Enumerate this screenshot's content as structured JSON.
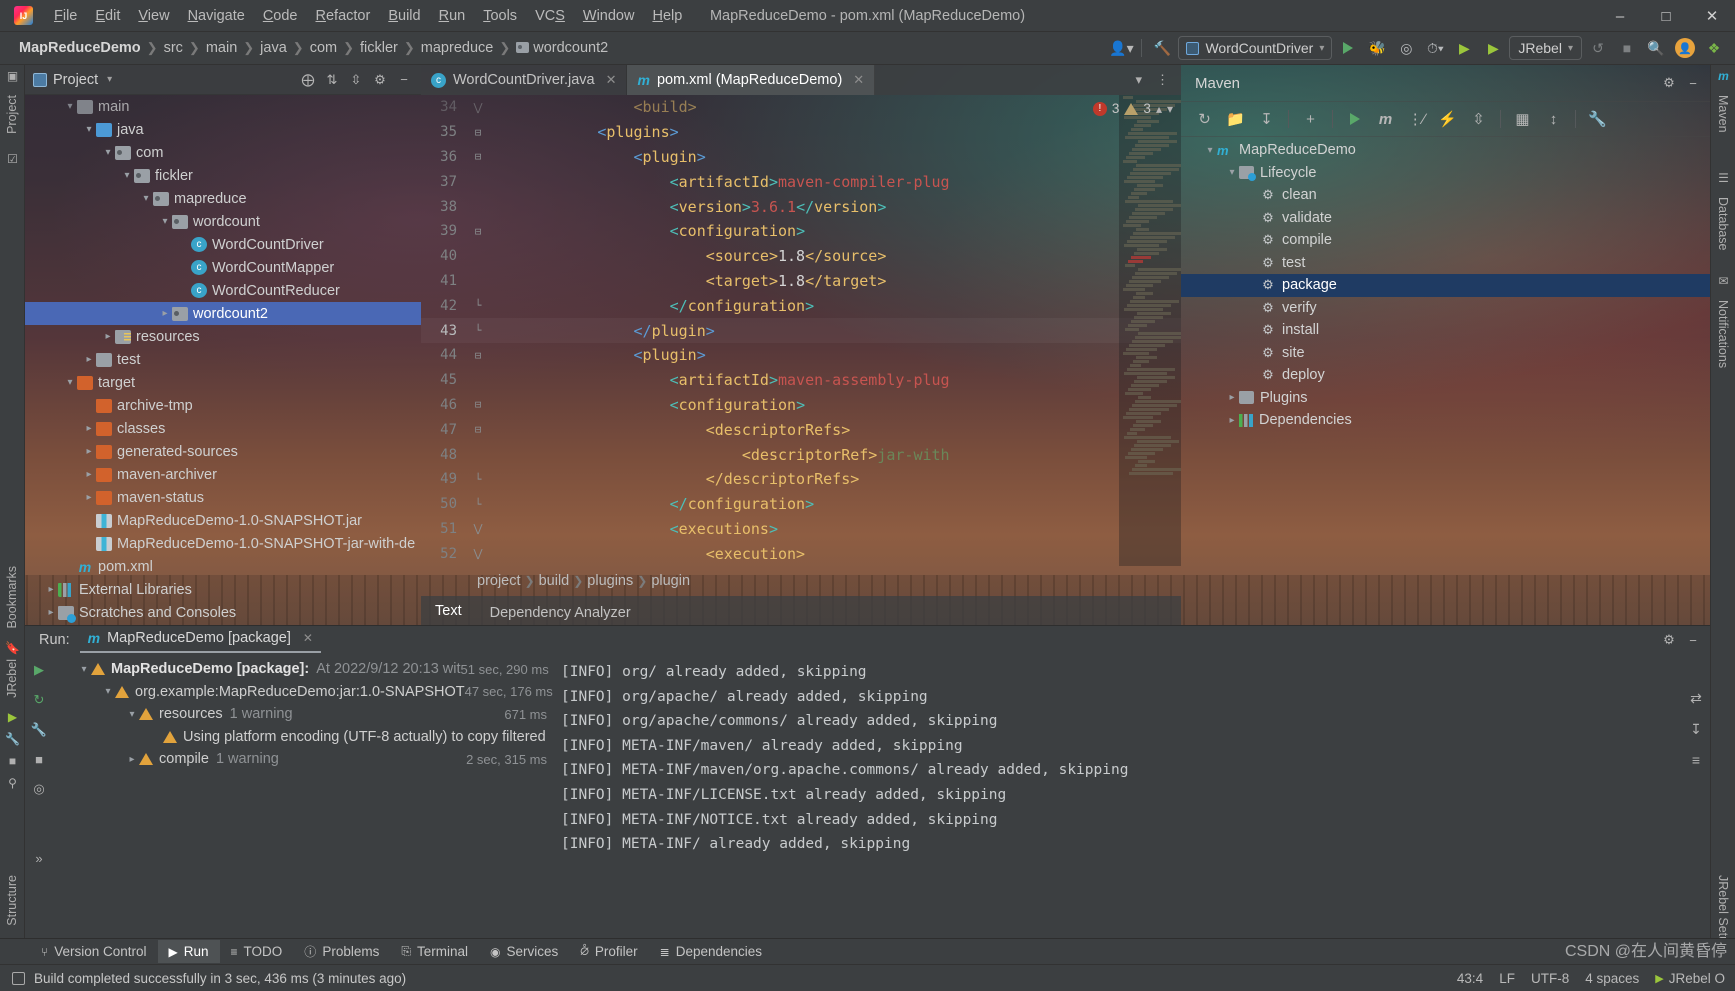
{
  "window": {
    "title": "MapReduceDemo - pom.xml (MapReduceDemo)",
    "minimize": "–",
    "maximize": "☐",
    "close": "✕"
  },
  "menu": [
    "File",
    "Edit",
    "View",
    "Navigate",
    "Code",
    "Refactor",
    "Build",
    "Run",
    "Tools",
    "VCS",
    "Window",
    "Help"
  ],
  "navbar": {
    "breadcrumbs": [
      "MapReduceDemo",
      "src",
      "main",
      "java",
      "com",
      "fickler",
      "mapreduce",
      "wordcount2"
    ],
    "run_config": "WordCountDriver",
    "jrebel_label": "JRebel",
    "icons": [
      "user-add-icon",
      "build-hammer-icon",
      "run-icon",
      "debug-icon",
      "run-coverage-icon",
      "profiler-icon",
      "jrebel-run-icon",
      "jrebel-debug-icon",
      "stop-icon",
      "search-icon",
      "update-icon",
      "plugin-icon"
    ]
  },
  "left_rail": [
    "Project",
    "Bookmarks",
    "JRebel",
    "Structure"
  ],
  "right_rail": [
    "Maven",
    "Database",
    "Notifications",
    "JRebel Setup"
  ],
  "project_panel": {
    "title": "Project",
    "header_icons": [
      "locate-icon",
      "expand-all-icon",
      "collapse-all-icon",
      "settings-icon",
      "hide-icon"
    ],
    "tree": [
      {
        "label": "main",
        "indent": 2,
        "arrow": "open",
        "icon": "folder",
        "partial": true
      },
      {
        "label": "java",
        "indent": 3,
        "arrow": "open",
        "icon": "folderblue"
      },
      {
        "label": "com",
        "indent": 4,
        "arrow": "open",
        "icon": "pkg"
      },
      {
        "label": "fickler",
        "indent": 5,
        "arrow": "open",
        "icon": "pkg"
      },
      {
        "label": "mapreduce",
        "indent": 6,
        "arrow": "open",
        "icon": "pkg"
      },
      {
        "label": "wordcount",
        "indent": 7,
        "arrow": "open",
        "icon": "pkg"
      },
      {
        "label": "WordCountDriver",
        "indent": 8,
        "arrow": "none",
        "icon": "cls"
      },
      {
        "label": "WordCountMapper",
        "indent": 8,
        "arrow": "none",
        "icon": "cls"
      },
      {
        "label": "WordCountReducer",
        "indent": 8,
        "arrow": "none",
        "icon": "cls"
      },
      {
        "label": "wordcount2",
        "indent": 7,
        "arrow": "closed",
        "icon": "pkg",
        "selected": true
      },
      {
        "label": "resources",
        "indent": 4,
        "arrow": "closed",
        "icon": "res"
      },
      {
        "label": "test",
        "indent": 3,
        "arrow": "closed",
        "icon": "folder"
      },
      {
        "label": "target",
        "indent": 2,
        "arrow": "open",
        "icon": "folderorange"
      },
      {
        "label": "archive-tmp",
        "indent": 3,
        "arrow": "none",
        "icon": "folderorange"
      },
      {
        "label": "classes",
        "indent": 3,
        "arrow": "closed",
        "icon": "folderorange"
      },
      {
        "label": "generated-sources",
        "indent": 3,
        "arrow": "closed",
        "icon": "folderorange"
      },
      {
        "label": "maven-archiver",
        "indent": 3,
        "arrow": "closed",
        "icon": "folderorange"
      },
      {
        "label": "maven-status",
        "indent": 3,
        "arrow": "closed",
        "icon": "folderorange"
      },
      {
        "label": "MapReduceDemo-1.0-SNAPSHOT.jar",
        "indent": 3,
        "arrow": "none",
        "icon": "jar"
      },
      {
        "label": "MapReduceDemo-1.0-SNAPSHOT-jar-with-de",
        "indent": 3,
        "arrow": "none",
        "icon": "jar"
      },
      {
        "label": "pom.xml",
        "indent": 2,
        "arrow": "none",
        "icon": "mvn"
      },
      {
        "label": "External Libraries",
        "indent": 1,
        "arrow": "closed",
        "icon": "lib"
      },
      {
        "label": "Scratches and Consoles",
        "indent": 1,
        "arrow": "closed",
        "icon": "scr"
      }
    ]
  },
  "editor": {
    "tabs": [
      {
        "label": "WordCountDriver.java",
        "icon": "java-class-icon",
        "active": false
      },
      {
        "label": "pom.xml (MapReduceDemo)",
        "icon": "maven-icon",
        "active": true
      }
    ],
    "inspection": {
      "errors": "3",
      "warnings": "3"
    },
    "lines": [
      {
        "num": "34",
        "fold": "open",
        "segments": [
          {
            "t": "                ",
            "c": ""
          },
          {
            "t": "<build>",
            "c": "tag"
          }
        ],
        "dim": true
      },
      {
        "num": "35",
        "fold": "minus",
        "segments": [
          {
            "t": "            ",
            "c": ""
          },
          {
            "t": "<",
            "c": "brkb"
          },
          {
            "t": "plugins",
            "c": "tag"
          },
          {
            "t": ">",
            "c": "brkb"
          }
        ]
      },
      {
        "num": "36",
        "fold": "minus",
        "segments": [
          {
            "t": "                ",
            "c": ""
          },
          {
            "t": "<",
            "c": "brkb"
          },
          {
            "t": "plugin",
            "c": "tag"
          },
          {
            "t": ">",
            "c": "brkb"
          }
        ]
      },
      {
        "num": "37",
        "fold": "",
        "segments": [
          {
            "t": "                    ",
            "c": ""
          },
          {
            "t": "<",
            "c": "brk"
          },
          {
            "t": "artifactId",
            "c": "tag"
          },
          {
            "t": ">",
            "c": "brk"
          },
          {
            "t": "maven-compiler-plug",
            "c": "red"
          }
        ]
      },
      {
        "num": "38",
        "fold": "",
        "segments": [
          {
            "t": "                    ",
            "c": ""
          },
          {
            "t": "<",
            "c": "brk"
          },
          {
            "t": "version",
            "c": "tag"
          },
          {
            "t": ">",
            "c": "brk"
          },
          {
            "t": "3.6.1",
            "c": "red"
          },
          {
            "t": "</",
            "c": "brk"
          },
          {
            "t": "version",
            "c": "tag"
          },
          {
            "t": ">",
            "c": "brk"
          }
        ]
      },
      {
        "num": "39",
        "fold": "minus",
        "segments": [
          {
            "t": "                    ",
            "c": ""
          },
          {
            "t": "<",
            "c": "brk"
          },
          {
            "t": "configuration",
            "c": "tag"
          },
          {
            "t": ">",
            "c": "brk"
          }
        ]
      },
      {
        "num": "40",
        "fold": "",
        "segments": [
          {
            "t": "                        ",
            "c": ""
          },
          {
            "t": "<",
            "c": "tag"
          },
          {
            "t": "source",
            "c": "tag"
          },
          {
            "t": ">",
            "c": "tag"
          },
          {
            "t": "1.8",
            "c": "val"
          },
          {
            "t": "</source>",
            "c": "tag"
          }
        ]
      },
      {
        "num": "41",
        "fold": "",
        "segments": [
          {
            "t": "                        ",
            "c": ""
          },
          {
            "t": "<target>",
            "c": "tag"
          },
          {
            "t": "1.8",
            "c": "val"
          },
          {
            "t": "</target>",
            "c": "tag"
          }
        ]
      },
      {
        "num": "42",
        "fold": "end",
        "segments": [
          {
            "t": "                    ",
            "c": ""
          },
          {
            "t": "</",
            "c": "brk"
          },
          {
            "t": "configuration",
            "c": "tag"
          },
          {
            "t": ">",
            "c": "brk"
          }
        ]
      },
      {
        "num": "43",
        "fold": "end",
        "segments": [
          {
            "t": "                ",
            "c": ""
          },
          {
            "t": "</",
            "c": "brkb"
          },
          {
            "t": "plugin",
            "c": "tag"
          },
          {
            "t": ">",
            "c": "brkb"
          }
        ],
        "current": true
      },
      {
        "num": "44",
        "fold": "minus",
        "segments": [
          {
            "t": "                ",
            "c": ""
          },
          {
            "t": "<",
            "c": "brkb"
          },
          {
            "t": "plugin",
            "c": "tag"
          },
          {
            "t": ">",
            "c": "brkb"
          }
        ]
      },
      {
        "num": "45",
        "fold": "",
        "segments": [
          {
            "t": "                    ",
            "c": ""
          },
          {
            "t": "<",
            "c": "brk"
          },
          {
            "t": "artifactId",
            "c": "tag"
          },
          {
            "t": ">",
            "c": "brk"
          },
          {
            "t": "maven-assembly-plug",
            "c": "red"
          }
        ]
      },
      {
        "num": "46",
        "fold": "minus",
        "segments": [
          {
            "t": "                    ",
            "c": ""
          },
          {
            "t": "<",
            "c": "brk"
          },
          {
            "t": "configuration",
            "c": "tag"
          },
          {
            "t": ">",
            "c": "brk"
          }
        ]
      },
      {
        "num": "47",
        "fold": "minus",
        "segments": [
          {
            "t": "                        ",
            "c": ""
          },
          {
            "t": "<descriptorRefs>",
            "c": "tag"
          }
        ]
      },
      {
        "num": "48",
        "fold": "",
        "segments": [
          {
            "t": "                            ",
            "c": ""
          },
          {
            "t": "<descriptorRef>",
            "c": "tag"
          },
          {
            "t": "jar-with",
            "c": "grn"
          }
        ]
      },
      {
        "num": "49",
        "fold": "end",
        "segments": [
          {
            "t": "                        ",
            "c": ""
          },
          {
            "t": "</descriptorRefs>",
            "c": "tag"
          }
        ]
      },
      {
        "num": "50",
        "fold": "end",
        "segments": [
          {
            "t": "                    ",
            "c": ""
          },
          {
            "t": "</",
            "c": "brk"
          },
          {
            "t": "configuration",
            "c": "tag"
          },
          {
            "t": ">",
            "c": "brk"
          }
        ]
      },
      {
        "num": "51",
        "fold": "open",
        "segments": [
          {
            "t": "                    ",
            "c": ""
          },
          {
            "t": "<",
            "c": "brk"
          },
          {
            "t": "executions",
            "c": "tag"
          },
          {
            "t": ">",
            "c": "brk"
          }
        ]
      },
      {
        "num": "52",
        "fold": "open",
        "segments": [
          {
            "t": "                        ",
            "c": ""
          },
          {
            "t": "<execution>",
            "c": "tag"
          }
        ]
      }
    ],
    "breadcrumb": [
      "project",
      "build",
      "plugins",
      "plugin"
    ],
    "bottom_tabs": [
      {
        "label": "Text",
        "active": true
      },
      {
        "label": "Dependency Analyzer",
        "active": false
      }
    ]
  },
  "maven_panel": {
    "title": "Maven",
    "toolbar_icons": [
      "reload-icon",
      "add-folder-icon",
      "download-sources-icon",
      "add-icon",
      "run-icon",
      "maven-goal-icon",
      "skip-tests-icon",
      "toggle-offline-icon",
      "collapse-all-icon",
      "show-dependencies-icon",
      "expand-icon",
      "settings-wrench-icon"
    ],
    "tree": [
      {
        "label": "MapReduceDemo",
        "indent": 1,
        "arrow": "open",
        "icon": "mvnm"
      },
      {
        "label": "Lifecycle",
        "indent": 2,
        "arrow": "open",
        "icon": "folder-cfg"
      },
      {
        "label": "clean",
        "indent": 3,
        "arrow": "none",
        "icon": "gear"
      },
      {
        "label": "validate",
        "indent": 3,
        "arrow": "none",
        "icon": "gear"
      },
      {
        "label": "compile",
        "indent": 3,
        "arrow": "none",
        "icon": "gear"
      },
      {
        "label": "test",
        "indent": 3,
        "arrow": "none",
        "icon": "gear"
      },
      {
        "label": "package",
        "indent": 3,
        "arrow": "none",
        "icon": "gear",
        "selected": true
      },
      {
        "label": "verify",
        "indent": 3,
        "arrow": "none",
        "icon": "gear"
      },
      {
        "label": "install",
        "indent": 3,
        "arrow": "none",
        "icon": "gear"
      },
      {
        "label": "site",
        "indent": 3,
        "arrow": "none",
        "icon": "gear"
      },
      {
        "label": "deploy",
        "indent": 3,
        "arrow": "none",
        "icon": "gear"
      },
      {
        "label": "Plugins",
        "indent": 2,
        "arrow": "closed",
        "icon": "folder"
      },
      {
        "label": "Dependencies",
        "indent": 2,
        "arrow": "closed",
        "icon": "bar"
      }
    ]
  },
  "run_panel": {
    "label": "Run:",
    "tab_title": "MapReduceDemo [package]",
    "gutter_icons": [
      "run-icon",
      "rerun-icon",
      "wrench-icon",
      "stop-icon",
      "filter-icon",
      "expand-icon"
    ],
    "tree": [
      {
        "label": "MapReduceDemo [package]:",
        "meta": "At 2022/9/12 20:13 wit",
        "time": "51 sec, 290 ms",
        "indent": 1,
        "arrow": "open",
        "bold": true
      },
      {
        "label": "org.example:MapReduceDemo:jar:1.0-SNAPSHOT",
        "meta": "",
        "time": "47 sec, 176 ms",
        "indent": 2,
        "arrow": "open",
        "bold": false
      },
      {
        "label": "resources",
        "meta": "1 warning",
        "time": "671 ms",
        "indent": 3,
        "arrow": "open",
        "bold": false
      },
      {
        "label": "Using platform encoding (UTF-8 actually) to copy filtered",
        "meta": "",
        "time": "",
        "indent": 4,
        "arrow": "none",
        "bold": false
      },
      {
        "label": "compile",
        "meta": "1 warning",
        "time": "2 sec, 315 ms",
        "indent": 3,
        "arrow": "closed",
        "bold": false
      }
    ],
    "console": [
      "[INFO] org/ already added, skipping",
      "[INFO] org/apache/ already added, skipping",
      "[INFO] org/apache/commons/ already added, skipping",
      "[INFO] META-INF/maven/ already added, skipping",
      "[INFO] META-INF/maven/org.apache.commons/ already added, skipping",
      "[INFO] META-INF/LICENSE.txt already added, skipping",
      "[INFO] META-INF/NOTICE.txt already added, skipping",
      "[INFO] META-INF/ already added, skipping"
    ]
  },
  "tool_tabs": [
    {
      "label": "Version Control",
      "icon": "branch-icon",
      "active": false
    },
    {
      "label": "Run",
      "icon": "run-icon",
      "active": true
    },
    {
      "label": "TODO",
      "icon": "list-icon",
      "active": false
    },
    {
      "label": "Problems",
      "icon": "problems-icon",
      "active": false
    },
    {
      "label": "Terminal",
      "icon": "terminal-icon",
      "active": false
    },
    {
      "label": "Services",
      "icon": "services-icon",
      "active": false
    },
    {
      "label": "Profiler",
      "icon": "profiler-icon",
      "active": false
    },
    {
      "label": "Dependencies",
      "icon": "dependencies-icon",
      "active": false
    }
  ],
  "status_bar": {
    "message": "Build completed successfully in 3 sec, 436 ms (3 minutes ago)",
    "caret": "43:4",
    "line_ending": "LF",
    "encoding": "UTF-8",
    "indent": "4 spaces",
    "jrebel": "JRebel O"
  },
  "watermark": "CSDN @在人间黄昏停"
}
